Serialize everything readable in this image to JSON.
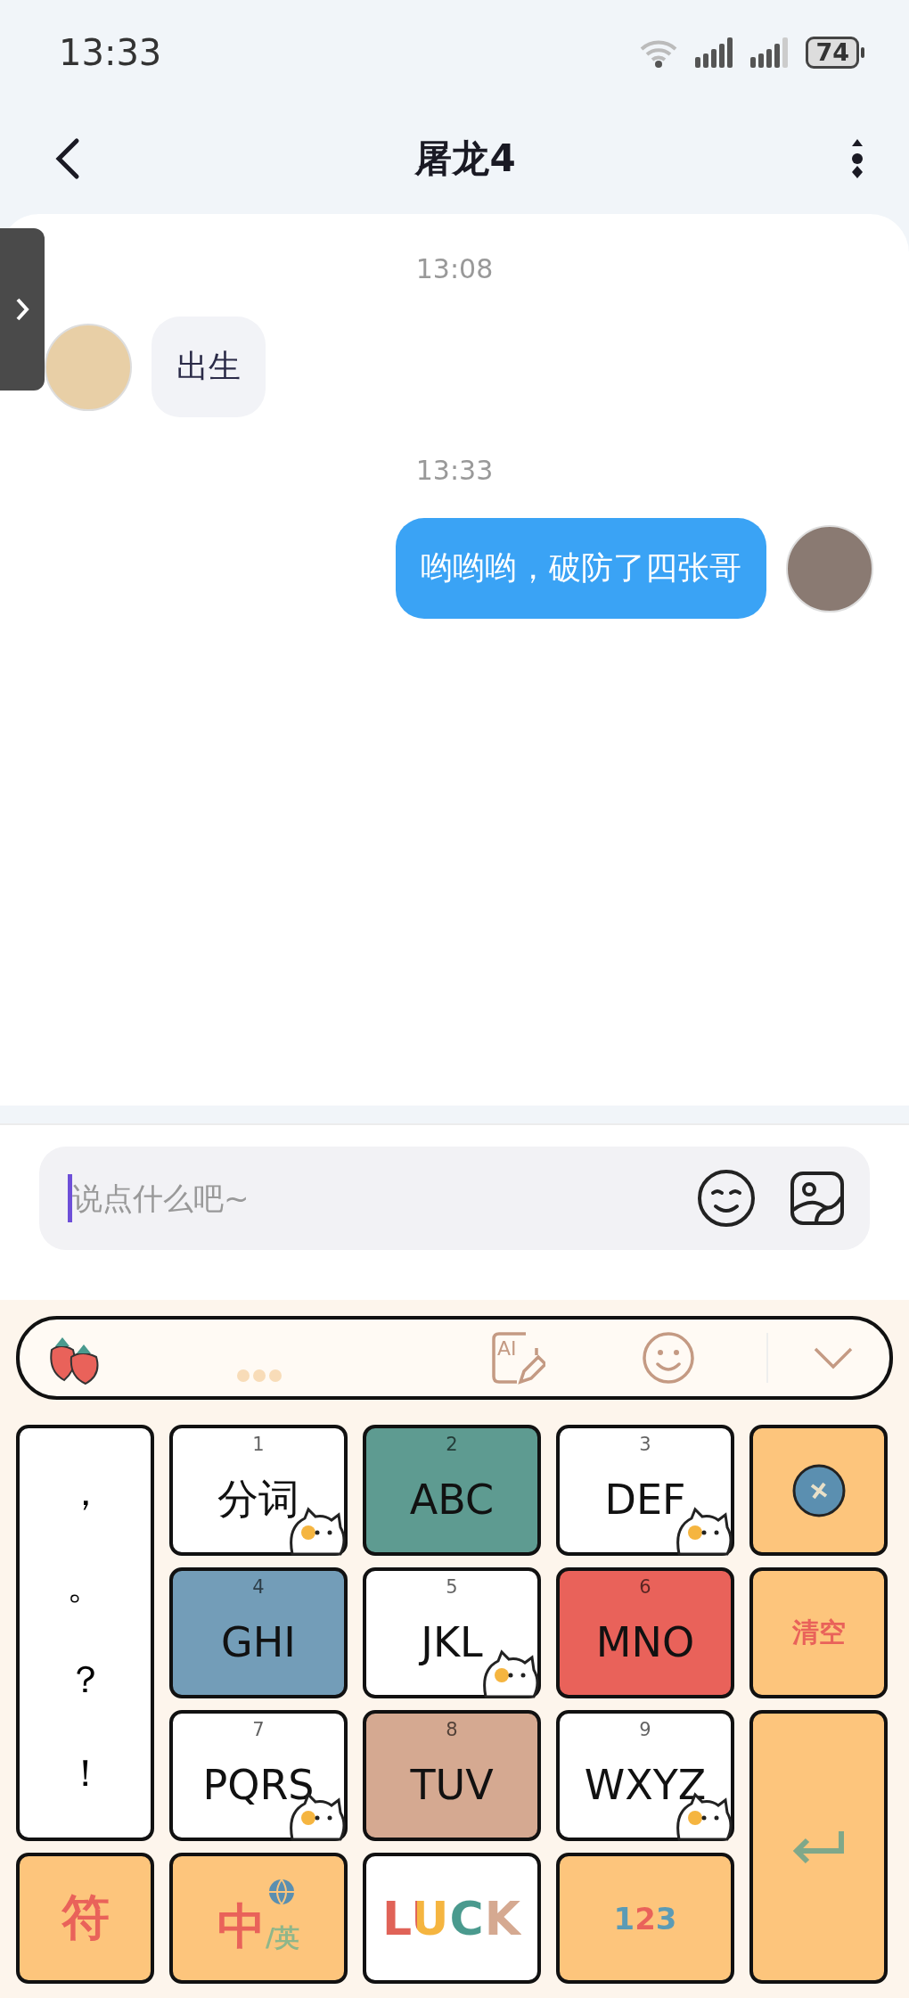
{
  "status_bar": {
    "time": "13:33",
    "battery": "74"
  },
  "header": {
    "title": "屠龙4"
  },
  "messages": [
    {
      "kind": "time",
      "text": "13:08"
    },
    {
      "kind": "incoming",
      "text": "出生"
    },
    {
      "kind": "time",
      "text": "13:33"
    },
    {
      "kind": "outgoing",
      "text": "哟哟哟，破防了四张哥"
    }
  ],
  "input": {
    "placeholder": "说点什么吧~"
  },
  "keyboard": {
    "toolbar": {
      "ai_label": "AI"
    },
    "keys": [
      {
        "kind": "punct",
        "marks": [
          "，",
          "。",
          "？",
          "！"
        ]
      },
      {
        "kind": "letter",
        "number": "1",
        "label": "分词",
        "color": "#ffffff",
        "sticker": true
      },
      {
        "kind": "letter",
        "number": "2",
        "label": "ABC",
        "color": "#5e9b91",
        "sticker": false
      },
      {
        "kind": "letter",
        "number": "3",
        "label": "DEF",
        "color": "#ffffff",
        "sticker": true
      },
      {
        "kind": "icon",
        "color": "#fdc57c"
      },
      {
        "kind": "letter",
        "number": "4",
        "label": "GHI",
        "color": "#739db8",
        "sticker": false
      },
      {
        "kind": "letter",
        "number": "5",
        "label": "JKL",
        "color": "#ffffff",
        "sticker": true
      },
      {
        "kind": "letter",
        "number": "6",
        "label": "MNO",
        "color": "#e9625a",
        "sticker": false
      },
      {
        "kind": "clear",
        "label": "清空",
        "color": "#fdc57c"
      },
      {
        "kind": "letter",
        "number": "7",
        "label": "PQRS",
        "color": "#ffffff",
        "sticker": true
      },
      {
        "kind": "letter",
        "number": "8",
        "label": "TUV",
        "color": "#d5a991",
        "sticker": false
      },
      {
        "kind": "letter",
        "number": "9",
        "label": "WXYZ",
        "color": "#ffffff",
        "sticker": true
      },
      {
        "kind": "enter",
        "color": "#fdc57c"
      },
      {
        "kind": "symbol",
        "label": "符",
        "color": "#fdc57c"
      },
      {
        "kind": "lang",
        "label": "中",
        "sub": "/英",
        "color": "#fdc57c"
      },
      {
        "kind": "luck",
        "label": "LUCK",
        "color": "#ffffff"
      },
      {
        "kind": "num",
        "label": "123",
        "color": "#fdc57c"
      }
    ]
  }
}
